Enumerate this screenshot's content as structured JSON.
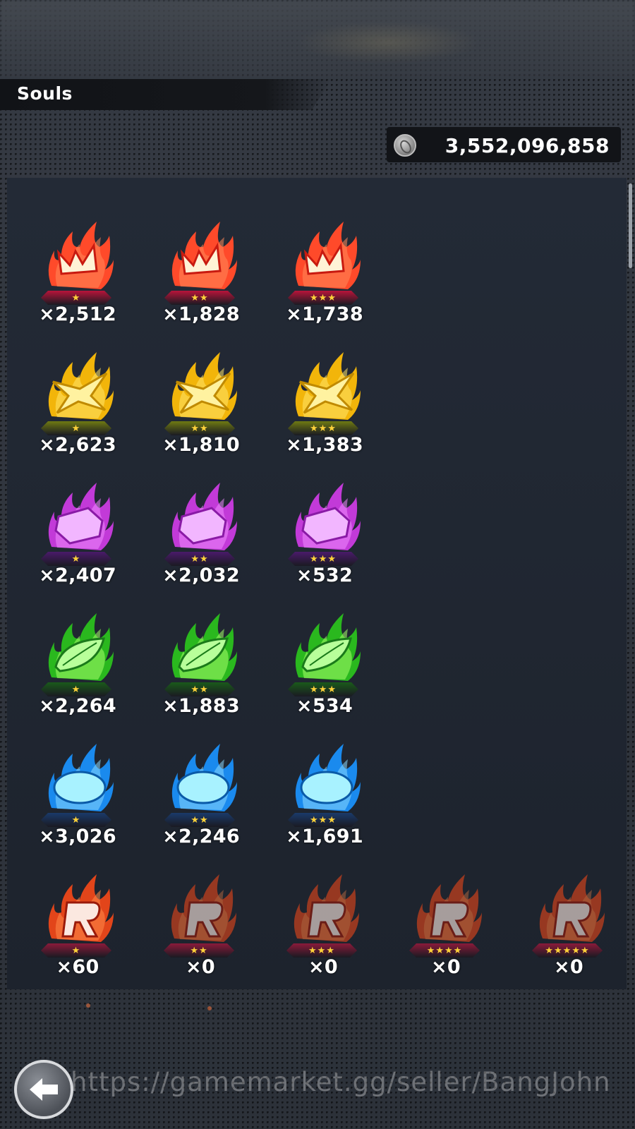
{
  "header": {
    "title": "Souls"
  },
  "currency": {
    "icon": "coin-icon",
    "value": "3,552,096,858"
  },
  "rows": [
    {
      "name": "red",
      "color": "#ff4a2a",
      "glow": "#ff8a5a",
      "badge": "#b8143a",
      "shape": "crown",
      "items": [
        {
          "stars": "★",
          "count": "×2,512"
        },
        {
          "stars": "★★",
          "count": "×1,828"
        },
        {
          "stars": "★★★",
          "count": "×1,738"
        }
      ]
    },
    {
      "name": "yellow",
      "color": "#f2b50a",
      "glow": "#ffe36a",
      "badge": "#6f7a12",
      "shape": "star",
      "items": [
        {
          "stars": "★",
          "count": "×2,623"
        },
        {
          "stars": "★★",
          "count": "×1,810"
        },
        {
          "stars": "★★★",
          "count": "×1,383"
        }
      ]
    },
    {
      "name": "purple",
      "color": "#c23ad8",
      "glow": "#f08aff",
      "badge": "#4a1a6a",
      "shape": "gem",
      "items": [
        {
          "stars": "★",
          "count": "×2,407"
        },
        {
          "stars": "★★",
          "count": "×2,032"
        },
        {
          "stars": "★★★",
          "count": "×532"
        }
      ]
    },
    {
      "name": "green",
      "color": "#2ab81e",
      "glow": "#a6ff6a",
      "badge": "#1a5a1a",
      "shape": "leaf",
      "items": [
        {
          "stars": "★",
          "count": "×2,264"
        },
        {
          "stars": "★★",
          "count": "×1,883"
        },
        {
          "stars": "★★★",
          "count": "×534"
        }
      ]
    },
    {
      "name": "blue",
      "color": "#1a8aee",
      "glow": "#8ad8ff",
      "badge": "#1a3a6a",
      "shape": "oval",
      "items": [
        {
          "stars": "★",
          "count": "×3,026"
        },
        {
          "stars": "★★",
          "count": "×2,246"
        },
        {
          "stars": "★★★",
          "count": "×1,691"
        }
      ]
    },
    {
      "name": "rainbow",
      "color": "#e2451a",
      "glow": "#ff8a4a",
      "badge": "#8a1a3a",
      "shape": "r",
      "items": [
        {
          "stars": "★",
          "count": "×60"
        },
        {
          "stars": "★★",
          "count": "×0"
        },
        {
          "stars": "★★★",
          "count": "×0"
        },
        {
          "stars": "★★★★",
          "count": "×0"
        },
        {
          "stars": "★★★★★",
          "count": "×0"
        }
      ]
    }
  ],
  "nav": {
    "back_icon": "arrow-left-icon"
  },
  "watermark": "https://gamemarket.gg/seller/BangJohn"
}
